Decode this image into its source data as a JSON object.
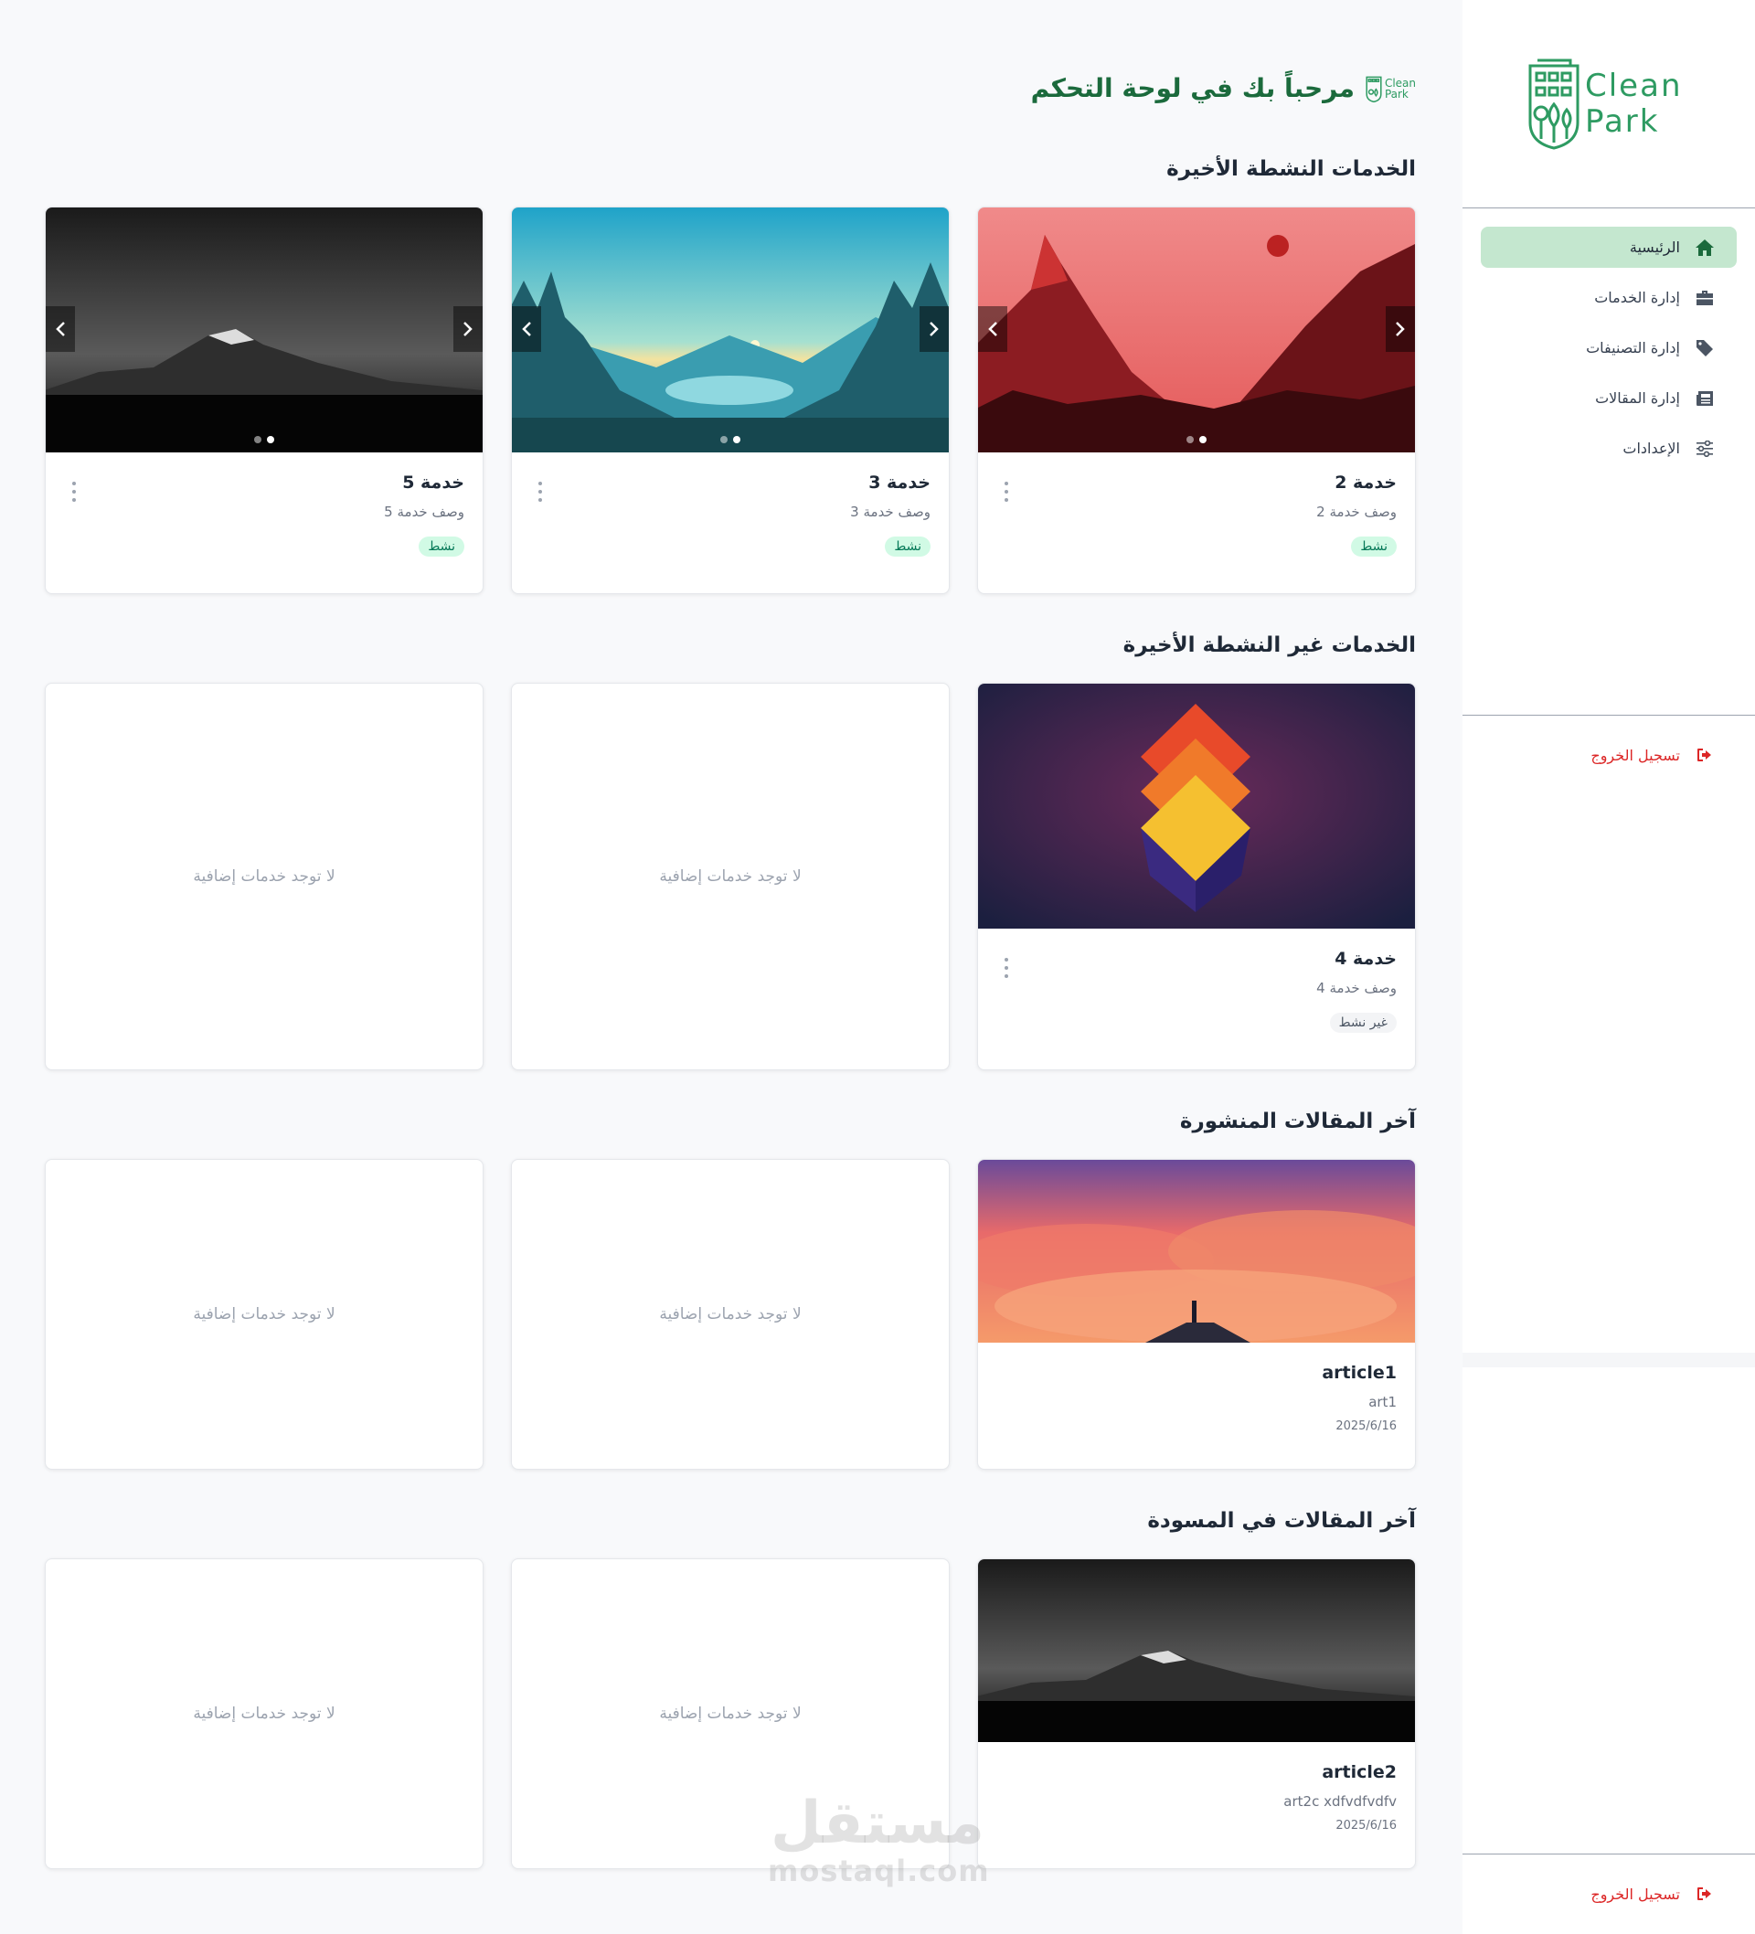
{
  "sidebar": {
    "logo": {
      "line1": "Clean",
      "line2": "Park"
    },
    "nav": [
      {
        "label": "الرئيسية",
        "icon": "home-icon",
        "active": true
      },
      {
        "label": "إدارة الخدمات",
        "icon": "briefcase-icon",
        "active": false
      },
      {
        "label": "إدارة التصنيفات",
        "icon": "tags-icon",
        "active": false
      },
      {
        "label": "إدارة المقالات",
        "icon": "newspaper-icon",
        "active": false
      },
      {
        "label": "الإعدادات",
        "icon": "sliders-icon",
        "active": false
      }
    ],
    "logout_label": "تسجيل الخروج"
  },
  "header": {
    "welcome": "مرحباً بك في لوحة التحكم",
    "mini_logo": {
      "line1": "Clean",
      "line2": "Park"
    }
  },
  "sections": {
    "active_services": {
      "title": "الخدمات النشطة الأخيرة",
      "cards": [
        {
          "title": "خدمة 2",
          "desc": "وصف خدمة 2",
          "status": "نشط"
        },
        {
          "title": "خدمة 3",
          "desc": "وصف خدمة 3",
          "status": "نشط"
        },
        {
          "title": "خدمة 5",
          "desc": "وصف خدمة 5",
          "status": "نشط"
        }
      ]
    },
    "inactive_services": {
      "title": "الخدمات غير النشطة الأخيرة",
      "cards": [
        {
          "title": "خدمة 4",
          "desc": "وصف خدمة 4",
          "status": "غير نشط"
        }
      ],
      "empty_text": "لا توجد خدمات إضافية"
    },
    "published_articles": {
      "title": "آخر المقالات المنشورة",
      "cards": [
        {
          "title": "article1",
          "desc": "art1",
          "date": "2025/6/16"
        }
      ],
      "empty_text": "لا توجد خدمات إضافية"
    },
    "draft_articles": {
      "title": "آخر المقالات في المسودة",
      "cards": [
        {
          "title": "article2",
          "desc": "art2c xdfvdfvdfv",
          "date": "2025/6/16"
        }
      ],
      "empty_text": "لا توجد خدمات إضافية"
    }
  },
  "watermark": {
    "arabic": "مستقل",
    "latin": "mostaql.com"
  },
  "colors": {
    "brand": "#1b6a3c",
    "accent": "#2e9b62",
    "active_nav": "#c4e7cf",
    "danger": "#dc2626"
  }
}
